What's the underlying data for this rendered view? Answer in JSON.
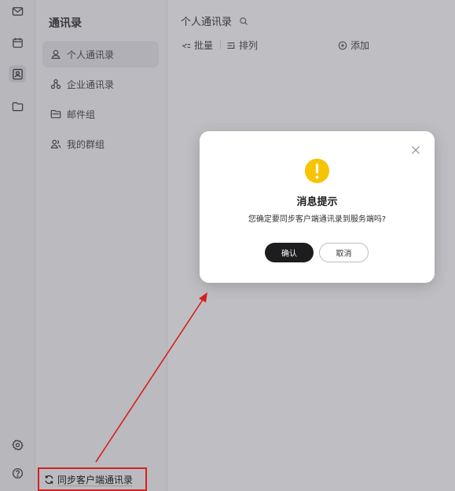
{
  "nav": {
    "title": "通讯录",
    "items": [
      {
        "label": "个人通讯录",
        "icon": "person-icon"
      },
      {
        "label": "企业通讯录",
        "icon": "org-tree-icon"
      },
      {
        "label": "邮件组",
        "icon": "mail-group-folder-icon"
      },
      {
        "label": "我的群组",
        "icon": "group-people-icon"
      }
    ],
    "sync_label": "同步客户端通讯录"
  },
  "main": {
    "title": "个人通讯录",
    "toolbar": {
      "batch": "批量",
      "sort": "排列",
      "add": "添加"
    }
  },
  "dialog": {
    "title": "消息提示",
    "message": "您确定要同步客户端通讯录到服务端吗?",
    "confirm_label": "确认",
    "cancel_label": "取消"
  },
  "colors": {
    "warning": "#f6c400",
    "annotation": "#d42020",
    "primary_button": "#1d1d1f"
  }
}
